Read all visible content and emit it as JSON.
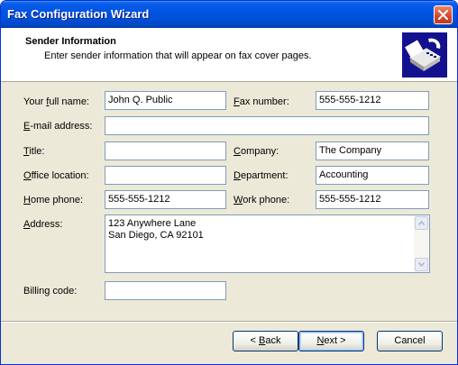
{
  "window": {
    "title": "Fax Configuration Wizard"
  },
  "header": {
    "title": "Sender Information",
    "subtitle": "Enter sender information that will appear on fax cover pages."
  },
  "icons": {
    "close": "close-icon",
    "header": "fax-machine-icon"
  },
  "form": {
    "full_name": {
      "label_pre": "Your ",
      "label_key": "f",
      "label_post": "ull name:",
      "value": "John Q. Public"
    },
    "fax_number": {
      "label_pre": "",
      "label_key": "F",
      "label_post": "ax number:",
      "value": "555-555-1212"
    },
    "email": {
      "label_pre": "",
      "label_key": "E",
      "label_post": "-mail address:",
      "value": ""
    },
    "title": {
      "label_pre": "",
      "label_key": "T",
      "label_post": "itle:",
      "value": ""
    },
    "company": {
      "label_pre": "",
      "label_key": "C",
      "label_post": "ompany:",
      "value": "The Company"
    },
    "office_location": {
      "label_pre": "",
      "label_key": "O",
      "label_post": "ffice location:",
      "value": ""
    },
    "department": {
      "label_pre": "",
      "label_key": "D",
      "label_post": "epartment:",
      "value": "Accounting"
    },
    "home_phone": {
      "label_pre": "",
      "label_key": "H",
      "label_post": "ome phone:",
      "value": "555-555-1212"
    },
    "work_phone": {
      "label_pre": "",
      "label_key": "W",
      "label_post": "ork phone:",
      "value": "555-555-1212"
    },
    "address": {
      "label_pre": "",
      "label_key": "A",
      "label_post": "ddress:",
      "value": "123 Anywhere Lane\nSan Diego, CA 92101"
    },
    "billing_code": {
      "label_pre": "Billing code:",
      "label_key": "",
      "label_post": "",
      "value": ""
    }
  },
  "buttons": {
    "back": {
      "pre": "< ",
      "key": "B",
      "post": "ack"
    },
    "next": {
      "pre": "",
      "key": "N",
      "post": "ext >"
    },
    "cancel": {
      "pre": "Cancel",
      "key": "",
      "post": ""
    }
  },
  "colors": {
    "titlebar": "#0054e3",
    "dialog": "#ece9d8",
    "header_icon_bg": "#13128e",
    "close_button": "#d2462a"
  }
}
